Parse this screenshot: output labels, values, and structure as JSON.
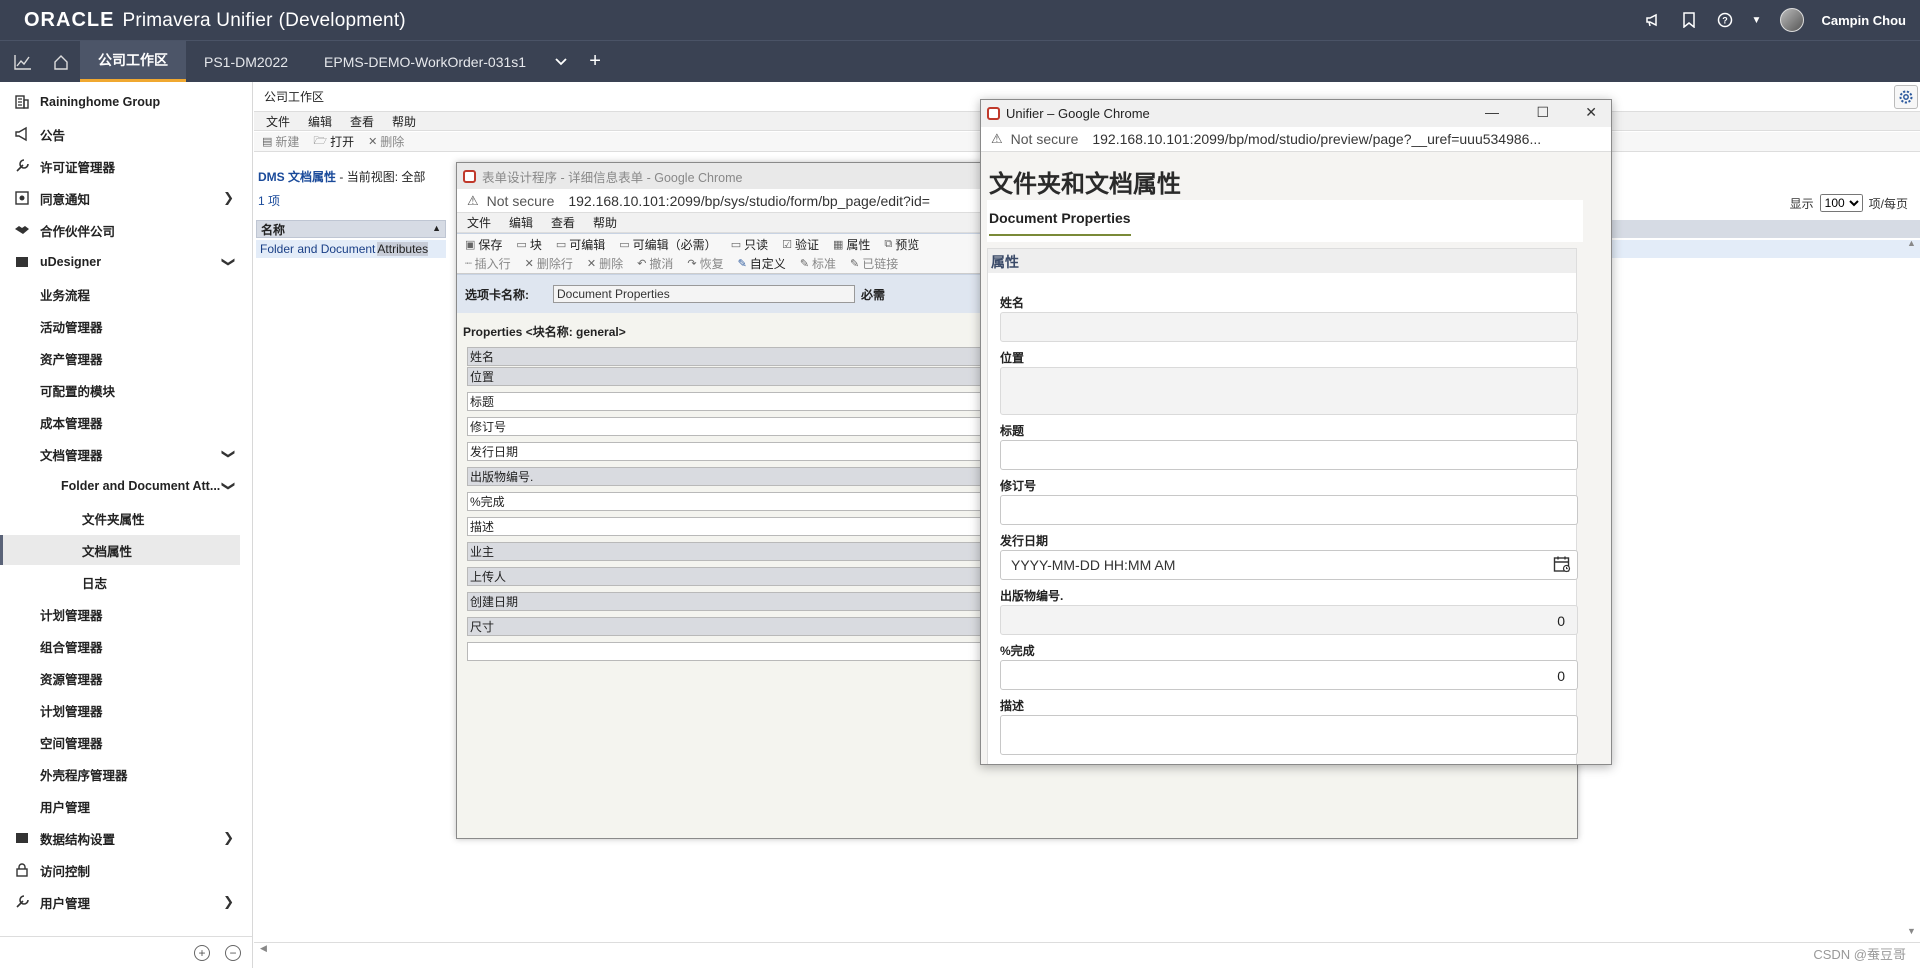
{
  "header": {
    "brand_oracle": "ORACLE",
    "brand_product": "Primavera Unifier",
    "brand_env": "(Development)",
    "username": "Campin Chou"
  },
  "tabs": [
    "公司工作区",
    "PS1-DM2022",
    "EPMS-DEMO-WorkOrder-031s1"
  ],
  "sidebar": {
    "items": [
      {
        "label": "Raininghome Group"
      },
      {
        "label": "公告"
      },
      {
        "label": "许可证管理器"
      },
      {
        "label": "同意通知"
      },
      {
        "label": "合作伙伴公司"
      },
      {
        "label": "uDesigner"
      },
      {
        "label": "业务流程"
      },
      {
        "label": "活动管理器"
      },
      {
        "label": "资产管理器"
      },
      {
        "label": "可配置的模块"
      },
      {
        "label": "成本管理器"
      },
      {
        "label": "文档管理器"
      },
      {
        "label": "Folder and Document Att..."
      },
      {
        "label": "文件夹属性"
      },
      {
        "label": "文档属性"
      },
      {
        "label": "日志"
      },
      {
        "label": "计划管理器"
      },
      {
        "label": "组合管理器"
      },
      {
        "label": "资源管理器"
      },
      {
        "label": "计划管理器"
      },
      {
        "label": "空间管理器"
      },
      {
        "label": "外壳程序管理器"
      },
      {
        "label": "用户管理"
      },
      {
        "label": "数据结构设置"
      },
      {
        "label": "访问控制"
      },
      {
        "label": "用户管理"
      }
    ]
  },
  "main": {
    "breadcrumb": "公司工作区",
    "menu": [
      "文件",
      "编辑",
      "查看",
      "帮助"
    ],
    "toolbar": [
      "新建",
      "打开",
      "删除"
    ],
    "dms_title": "DMS 文档属性",
    "view_label": "- 当前视图: 全部",
    "item_count": "1 项",
    "grid_header": "名称",
    "grid_row_a": "Folder and Document",
    "grid_row_b": "Attributes",
    "pager_show": "显示",
    "pager_value": "100",
    "pager_per": "项/每页",
    "watermark": "CSDN @蚕豆哥"
  },
  "designer": {
    "title": "表单设计程序 - 详细信息表单 - Google Chrome",
    "not_secure": "Not secure",
    "url": "192.168.10.101:2099/bp/sys/studio/form/bp_page/edit?id=",
    "menu": [
      "文件",
      "编辑",
      "查看",
      "帮助"
    ],
    "toolbar1": [
      "保存",
      "块",
      "可编辑",
      "可编辑（必需）",
      "只读",
      "验证",
      "属性",
      "预览"
    ],
    "toolbar2": [
      "插入行",
      "删除行",
      "删除",
      "撤消",
      "恢复",
      "自定义",
      "标准",
      "已链接"
    ],
    "tabname_label": "选项卡名称:",
    "tabname_value": "Document Properties",
    "required": "必需",
    "block_label": "Properties <块名称: general>",
    "rows": [
      {
        "label": "姓名",
        "style": "gray"
      },
      {
        "label": "位置",
        "style": "gray"
      },
      {
        "label": "标题",
        "style": "white"
      },
      {
        "label": "修订号",
        "style": "white"
      },
      {
        "label": "发行日期",
        "style": "white"
      },
      {
        "label": "出版物编号.",
        "style": "gray"
      },
      {
        "label": "%完成",
        "style": "white"
      },
      {
        "label": "描述",
        "style": "white"
      },
      {
        "label": "业主",
        "style": "gray"
      },
      {
        "label": "上传人",
        "style": "gray"
      },
      {
        "label": "创建日期",
        "style": "gray"
      },
      {
        "label": "尺寸",
        "style": "gray"
      },
      {
        "label": "",
        "style": "white"
      }
    ]
  },
  "preview": {
    "title": "Unifier – Google Chrome",
    "not_secure": "Not secure",
    "url": "192.168.10.101:2099/bp/mod/studio/preview/page?__uref=uuu534986...",
    "heading": "文件夹和文档属性",
    "tab": "Document Properties",
    "section": "属性",
    "labels": {
      "name": "姓名",
      "location": "位置",
      "title": "标题",
      "revision": "修订号",
      "issue_date": "发行日期",
      "pub_no": "出版物编号.",
      "percent": "%完成",
      "description": "描述"
    },
    "date_placeholder": "YYYY-MM-DD HH:MM AM",
    "pub_no_value": "0",
    "percent_value": "0"
  }
}
